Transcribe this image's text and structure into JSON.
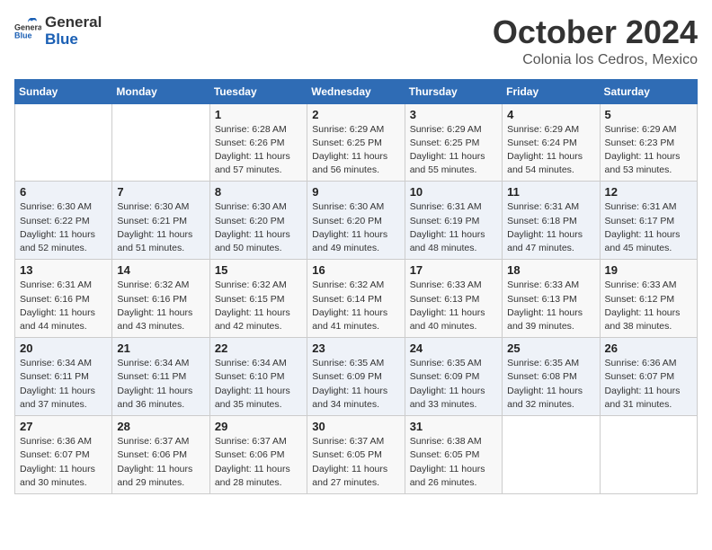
{
  "header": {
    "logo_general": "General",
    "logo_blue": "Blue",
    "month_year": "October 2024",
    "location": "Colonia los Cedros, Mexico"
  },
  "weekdays": [
    "Sunday",
    "Monday",
    "Tuesday",
    "Wednesday",
    "Thursday",
    "Friday",
    "Saturday"
  ],
  "weeks": [
    [
      {
        "day": "",
        "sunrise": "",
        "sunset": "",
        "daylight": ""
      },
      {
        "day": "",
        "sunrise": "",
        "sunset": "",
        "daylight": ""
      },
      {
        "day": "1",
        "sunrise": "Sunrise: 6:28 AM",
        "sunset": "Sunset: 6:26 PM",
        "daylight": "Daylight: 11 hours and 57 minutes."
      },
      {
        "day": "2",
        "sunrise": "Sunrise: 6:29 AM",
        "sunset": "Sunset: 6:25 PM",
        "daylight": "Daylight: 11 hours and 56 minutes."
      },
      {
        "day": "3",
        "sunrise": "Sunrise: 6:29 AM",
        "sunset": "Sunset: 6:25 PM",
        "daylight": "Daylight: 11 hours and 55 minutes."
      },
      {
        "day": "4",
        "sunrise": "Sunrise: 6:29 AM",
        "sunset": "Sunset: 6:24 PM",
        "daylight": "Daylight: 11 hours and 54 minutes."
      },
      {
        "day": "5",
        "sunrise": "Sunrise: 6:29 AM",
        "sunset": "Sunset: 6:23 PM",
        "daylight": "Daylight: 11 hours and 53 minutes."
      }
    ],
    [
      {
        "day": "6",
        "sunrise": "Sunrise: 6:30 AM",
        "sunset": "Sunset: 6:22 PM",
        "daylight": "Daylight: 11 hours and 52 minutes."
      },
      {
        "day": "7",
        "sunrise": "Sunrise: 6:30 AM",
        "sunset": "Sunset: 6:21 PM",
        "daylight": "Daylight: 11 hours and 51 minutes."
      },
      {
        "day": "8",
        "sunrise": "Sunrise: 6:30 AM",
        "sunset": "Sunset: 6:20 PM",
        "daylight": "Daylight: 11 hours and 50 minutes."
      },
      {
        "day": "9",
        "sunrise": "Sunrise: 6:30 AM",
        "sunset": "Sunset: 6:20 PM",
        "daylight": "Daylight: 11 hours and 49 minutes."
      },
      {
        "day": "10",
        "sunrise": "Sunrise: 6:31 AM",
        "sunset": "Sunset: 6:19 PM",
        "daylight": "Daylight: 11 hours and 48 minutes."
      },
      {
        "day": "11",
        "sunrise": "Sunrise: 6:31 AM",
        "sunset": "Sunset: 6:18 PM",
        "daylight": "Daylight: 11 hours and 47 minutes."
      },
      {
        "day": "12",
        "sunrise": "Sunrise: 6:31 AM",
        "sunset": "Sunset: 6:17 PM",
        "daylight": "Daylight: 11 hours and 45 minutes."
      }
    ],
    [
      {
        "day": "13",
        "sunrise": "Sunrise: 6:31 AM",
        "sunset": "Sunset: 6:16 PM",
        "daylight": "Daylight: 11 hours and 44 minutes."
      },
      {
        "day": "14",
        "sunrise": "Sunrise: 6:32 AM",
        "sunset": "Sunset: 6:16 PM",
        "daylight": "Daylight: 11 hours and 43 minutes."
      },
      {
        "day": "15",
        "sunrise": "Sunrise: 6:32 AM",
        "sunset": "Sunset: 6:15 PM",
        "daylight": "Daylight: 11 hours and 42 minutes."
      },
      {
        "day": "16",
        "sunrise": "Sunrise: 6:32 AM",
        "sunset": "Sunset: 6:14 PM",
        "daylight": "Daylight: 11 hours and 41 minutes."
      },
      {
        "day": "17",
        "sunrise": "Sunrise: 6:33 AM",
        "sunset": "Sunset: 6:13 PM",
        "daylight": "Daylight: 11 hours and 40 minutes."
      },
      {
        "day": "18",
        "sunrise": "Sunrise: 6:33 AM",
        "sunset": "Sunset: 6:13 PM",
        "daylight": "Daylight: 11 hours and 39 minutes."
      },
      {
        "day": "19",
        "sunrise": "Sunrise: 6:33 AM",
        "sunset": "Sunset: 6:12 PM",
        "daylight": "Daylight: 11 hours and 38 minutes."
      }
    ],
    [
      {
        "day": "20",
        "sunrise": "Sunrise: 6:34 AM",
        "sunset": "Sunset: 6:11 PM",
        "daylight": "Daylight: 11 hours and 37 minutes."
      },
      {
        "day": "21",
        "sunrise": "Sunrise: 6:34 AM",
        "sunset": "Sunset: 6:11 PM",
        "daylight": "Daylight: 11 hours and 36 minutes."
      },
      {
        "day": "22",
        "sunrise": "Sunrise: 6:34 AM",
        "sunset": "Sunset: 6:10 PM",
        "daylight": "Daylight: 11 hours and 35 minutes."
      },
      {
        "day": "23",
        "sunrise": "Sunrise: 6:35 AM",
        "sunset": "Sunset: 6:09 PM",
        "daylight": "Daylight: 11 hours and 34 minutes."
      },
      {
        "day": "24",
        "sunrise": "Sunrise: 6:35 AM",
        "sunset": "Sunset: 6:09 PM",
        "daylight": "Daylight: 11 hours and 33 minutes."
      },
      {
        "day": "25",
        "sunrise": "Sunrise: 6:35 AM",
        "sunset": "Sunset: 6:08 PM",
        "daylight": "Daylight: 11 hours and 32 minutes."
      },
      {
        "day": "26",
        "sunrise": "Sunrise: 6:36 AM",
        "sunset": "Sunset: 6:07 PM",
        "daylight": "Daylight: 11 hours and 31 minutes."
      }
    ],
    [
      {
        "day": "27",
        "sunrise": "Sunrise: 6:36 AM",
        "sunset": "Sunset: 6:07 PM",
        "daylight": "Daylight: 11 hours and 30 minutes."
      },
      {
        "day": "28",
        "sunrise": "Sunrise: 6:37 AM",
        "sunset": "Sunset: 6:06 PM",
        "daylight": "Daylight: 11 hours and 29 minutes."
      },
      {
        "day": "29",
        "sunrise": "Sunrise: 6:37 AM",
        "sunset": "Sunset: 6:06 PM",
        "daylight": "Daylight: 11 hours and 28 minutes."
      },
      {
        "day": "30",
        "sunrise": "Sunrise: 6:37 AM",
        "sunset": "Sunset: 6:05 PM",
        "daylight": "Daylight: 11 hours and 27 minutes."
      },
      {
        "day": "31",
        "sunrise": "Sunrise: 6:38 AM",
        "sunset": "Sunset: 6:05 PM",
        "daylight": "Daylight: 11 hours and 26 minutes."
      },
      {
        "day": "",
        "sunrise": "",
        "sunset": "",
        "daylight": ""
      },
      {
        "day": "",
        "sunrise": "",
        "sunset": "",
        "daylight": ""
      }
    ]
  ]
}
